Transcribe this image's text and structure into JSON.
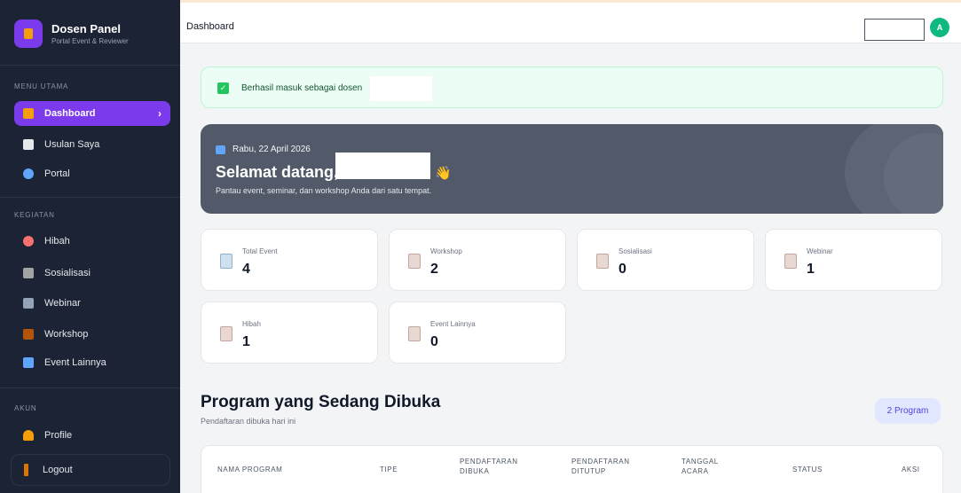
{
  "sidebar": {
    "brand_title": "Dosen Panel",
    "brand_subtitle": "Portal Event & Reviewer",
    "sections": {
      "main": "MENU UTAMA",
      "activities": "KEGIATAN",
      "account": "AKUN"
    },
    "items": {
      "dashboard": "Dashboard",
      "proposals": "Usulan Saya",
      "portal": "Portal",
      "grant": "Hibah",
      "socialization": "Sosialisasi",
      "webinar": "Webinar",
      "workshop": "Workshop",
      "other_events": "Event Lainnya",
      "profile": "Profile",
      "logout": "Logout"
    },
    "active_chevron": "›"
  },
  "header": {
    "title": "Dashboard",
    "avatar_initial": "A"
  },
  "alert": {
    "message": "Berhasil masuk sebagai dosen",
    "check": "✓"
  },
  "welcome": {
    "date": "Rabu, 22 April 2026",
    "greeting": "Selamat datang,",
    "wave": "👋",
    "subtitle": "Pantau event, seminar, dan workshop Anda dari satu tempat."
  },
  "stats": [
    {
      "label": "Total Event",
      "value": "4",
      "icon": "calendar-icon"
    },
    {
      "label": "Workshop",
      "value": "2",
      "icon": "clipboard-icon"
    },
    {
      "label": "Sosialisasi",
      "value": "0",
      "icon": "clipboard-icon"
    },
    {
      "label": "Webinar",
      "value": "1",
      "icon": "clipboard-icon"
    },
    {
      "label": "Hibah",
      "value": "1",
      "icon": "clipboard-icon"
    },
    {
      "label": "Event Lainnya",
      "value": "0",
      "icon": "clipboard-icon"
    }
  ],
  "programs": {
    "title": "Program yang Sedang Dibuka",
    "subtitle": "Pendaftaran dibuka hari ini",
    "count_badge": "2 Program",
    "columns": {
      "name": "NAMA PROGRAM",
      "type": "TIPE",
      "open_1": "PENDAFTARAN",
      "open_2": "DIBUKA",
      "close_1": "PENDAFTARAN",
      "close_2": "DITUTUP",
      "date_1": "TANGGAL",
      "date_2": "ACARA",
      "status": "STATUS",
      "action": "AKSI"
    }
  },
  "colors": {
    "sidebar_bg": "#1c2334",
    "accent": "#7c3aed",
    "success": "#22c55e",
    "welcome_bg": "#525a6a",
    "avatar": "#10b981"
  }
}
